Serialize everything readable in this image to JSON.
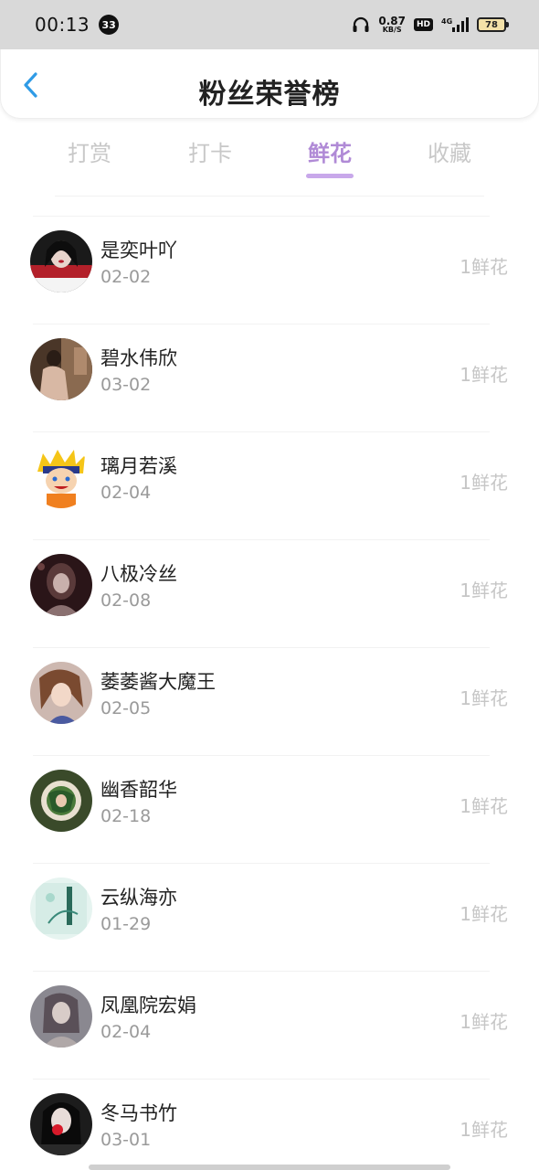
{
  "status_bar": {
    "time": "00:13",
    "notification_count": "33",
    "net_speed_value": "0.87",
    "net_speed_unit": "KB/S",
    "hd_label": "HD",
    "network_type": "4G",
    "battery_level": "78",
    "icons": [
      "headphones-icon",
      "signal-icon",
      "battery-icon"
    ]
  },
  "header": {
    "title": "粉丝荣誉榜",
    "back_icon": "chevron-left-icon",
    "accent_color": "#2f9be6"
  },
  "tabs": {
    "items": [
      {
        "label": "打赏",
        "active": false
      },
      {
        "label": "打卡",
        "active": false
      },
      {
        "label": "鲜花",
        "active": true
      },
      {
        "label": "收藏",
        "active": false
      }
    ],
    "active_color": "#b08ad6",
    "inactive_color": "#c8c8c8"
  },
  "list": {
    "rows": [
      {
        "name": "是奕叶吖",
        "date": "02-02",
        "amount": "1鲜花"
      },
      {
        "name": "碧水伟欣",
        "date": "03-02",
        "amount": "1鲜花"
      },
      {
        "name": "璃月若溪",
        "date": "02-04",
        "amount": "1鲜花"
      },
      {
        "name": "八极冷丝",
        "date": "02-08",
        "amount": "1鲜花"
      },
      {
        "name": "萎萎酱大魔王",
        "date": "02-05",
        "amount": "1鲜花"
      },
      {
        "name": "幽香韶华",
        "date": "02-18",
        "amount": "1鲜花"
      },
      {
        "name": "云纵海亦",
        "date": "01-29",
        "amount": "1鲜花"
      },
      {
        "name": "凤凰院宏娟",
        "date": "02-04",
        "amount": "1鲜花"
      },
      {
        "name": "冬马书竹",
        "date": "03-01",
        "amount": "1鲜花"
      }
    ]
  }
}
